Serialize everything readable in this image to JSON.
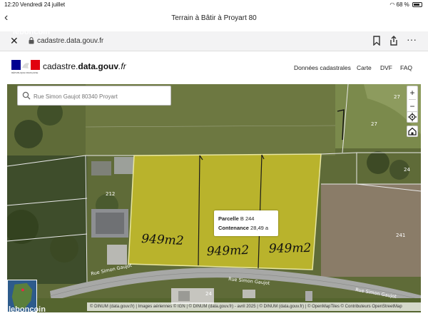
{
  "status_bar": {
    "time": "12:20",
    "date": "Vendredi 24 juillet",
    "battery": "68 %"
  },
  "title_bar": {
    "title": "Terrain à Bâtir à Proyart 80"
  },
  "url_bar": {
    "url": "cadastre.data.gouv.fr",
    "icons": [
      "close-icon",
      "lock-icon",
      "bookmark-icon",
      "share-icon",
      "more-icon"
    ]
  },
  "site_header": {
    "logo_caption": "RÉPUBLIQUE FRANÇAISE",
    "brand_name": "cadastre.",
    "brand_bold": "data.gouv",
    "brand_suffix": ".fr",
    "nav": [
      "Données cadastrales",
      "Carte",
      "DVF",
      "FAQ"
    ]
  },
  "map": {
    "search_placeholder": "Rue Simon Gaujot 80340 Proyart",
    "zoom_in": "+",
    "zoom_out": "−",
    "parcel_numbers": [
      "27",
      "27",
      "24",
      "212",
      "241",
      "24"
    ],
    "road_labels": [
      "Rue Simon Gaujot",
      "Rue Simon Gaujot",
      "Rue Simon Gaujot"
    ],
    "handwritten_areas": [
      "949m2",
      "949m2",
      "949m2"
    ],
    "popup": {
      "label1": "Parcelle",
      "value1": "B 244",
      "label2": "Contenance",
      "value2": "28,49 a"
    },
    "attribution": "© DINUM (data.gouv.fr) | Images aériennes © IGN | © DINUM (data.gouv.fr) - avril 2025 | © DINUM (data.gouv.fr) | © OpenMapTiles © Contributeurs OpenStreetMap",
    "selected_color": "#b9b32c"
  },
  "watermark": {
    "text": "leboncoin"
  }
}
